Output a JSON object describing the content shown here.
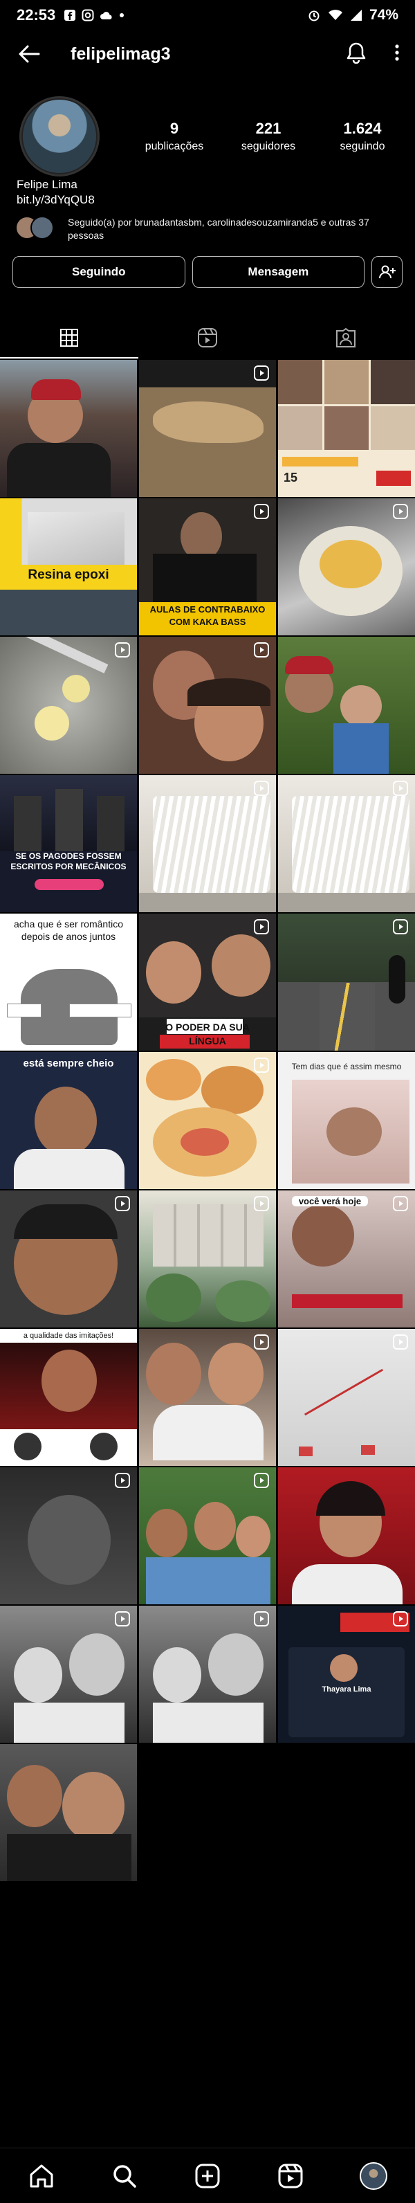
{
  "status_bar": {
    "time": "22:53",
    "battery": "74%"
  },
  "header": {
    "username": "felipelimag3"
  },
  "profile": {
    "stats": [
      {
        "value": "9",
        "label": "publicações"
      },
      {
        "value": "221",
        "label": "seguidores"
      },
      {
        "value": "1.624",
        "label": "seguindo"
      }
    ],
    "name": "Felipe Lima",
    "link": "bit.ly/3dYqQU8",
    "followed_by": "Seguido(a) por brunadantasbm, carolinadesouzamiranda5 e outras 37 pessoas"
  },
  "actions": {
    "follow": "Seguindo",
    "message": "Mensagem"
  },
  "posts": [
    {
      "caption": ""
    },
    {
      "caption": ""
    },
    {
      "caption": ""
    },
    {
      "caption": "Resina epoxi"
    },
    {
      "caption": "AULAS DE CONTRABAIXO COM KAKA BASS"
    },
    {
      "caption": ""
    },
    {
      "caption": ""
    },
    {
      "caption": ""
    },
    {
      "caption": ""
    },
    {
      "caption": "SE OS PAGODES FOSSEM ESCRITOS POR MECÂNICOS"
    },
    {
      "caption": ""
    },
    {
      "caption": ""
    },
    {
      "caption": "acha que é ser romântico depois de anos juntos"
    },
    {
      "caption": "O PODER DA SUA LÍNGUA"
    },
    {
      "caption": ""
    },
    {
      "caption": "está sempre cheio"
    },
    {
      "caption": ""
    },
    {
      "caption": "Tem dias que é assim mesmo"
    },
    {
      "caption": ""
    },
    {
      "caption": ""
    },
    {
      "caption": "você verá hoje"
    },
    {
      "caption": "a qualidade das imitações!"
    },
    {
      "caption": ""
    },
    {
      "caption": ""
    },
    {
      "caption": ""
    },
    {
      "caption": ""
    },
    {
      "caption": ""
    },
    {
      "caption": ""
    },
    {
      "caption": ""
    },
    {
      "caption": "Thayara Lima"
    },
    {
      "caption": ""
    }
  ],
  "colors": {
    "background": "#000000",
    "text": "#ffffff",
    "border": "#bbbbbb"
  }
}
